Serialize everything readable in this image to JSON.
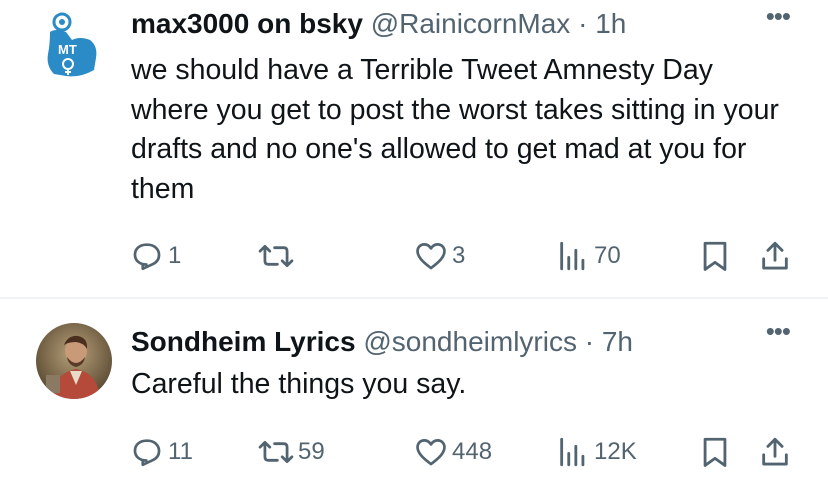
{
  "tweets": [
    {
      "display_name": "max3000 on bsky",
      "handle": "@RainicornMax",
      "separator": "·",
      "time": "1h",
      "avatar_icon": "flexing-arm-trans-symbol-avatar",
      "avatar_text": "MT",
      "text": "we should have a Terrible Tweet Amnesty Day where you get to post the worst takes sitting in your drafts and no one's allowed to get mad at you for them",
      "more_label": "•••",
      "reply_count": "1",
      "retweet_count": "",
      "like_count": "3",
      "view_count": "70"
    },
    {
      "display_name": "Sondheim Lyrics",
      "handle": "@sondheimlyrics",
      "separator": "·",
      "time": "7h",
      "avatar_icon": "man-portrait-avatar",
      "text": "Careful the things you say.",
      "more_label": "•••",
      "reply_count": "11",
      "retweet_count": "59",
      "like_count": "448",
      "view_count": "12K"
    }
  ],
  "colors": {
    "text_primary": "#0f1419",
    "text_secondary": "#536471",
    "divider": "#eff3f4",
    "avatar_blue": "#2a8bc7"
  }
}
